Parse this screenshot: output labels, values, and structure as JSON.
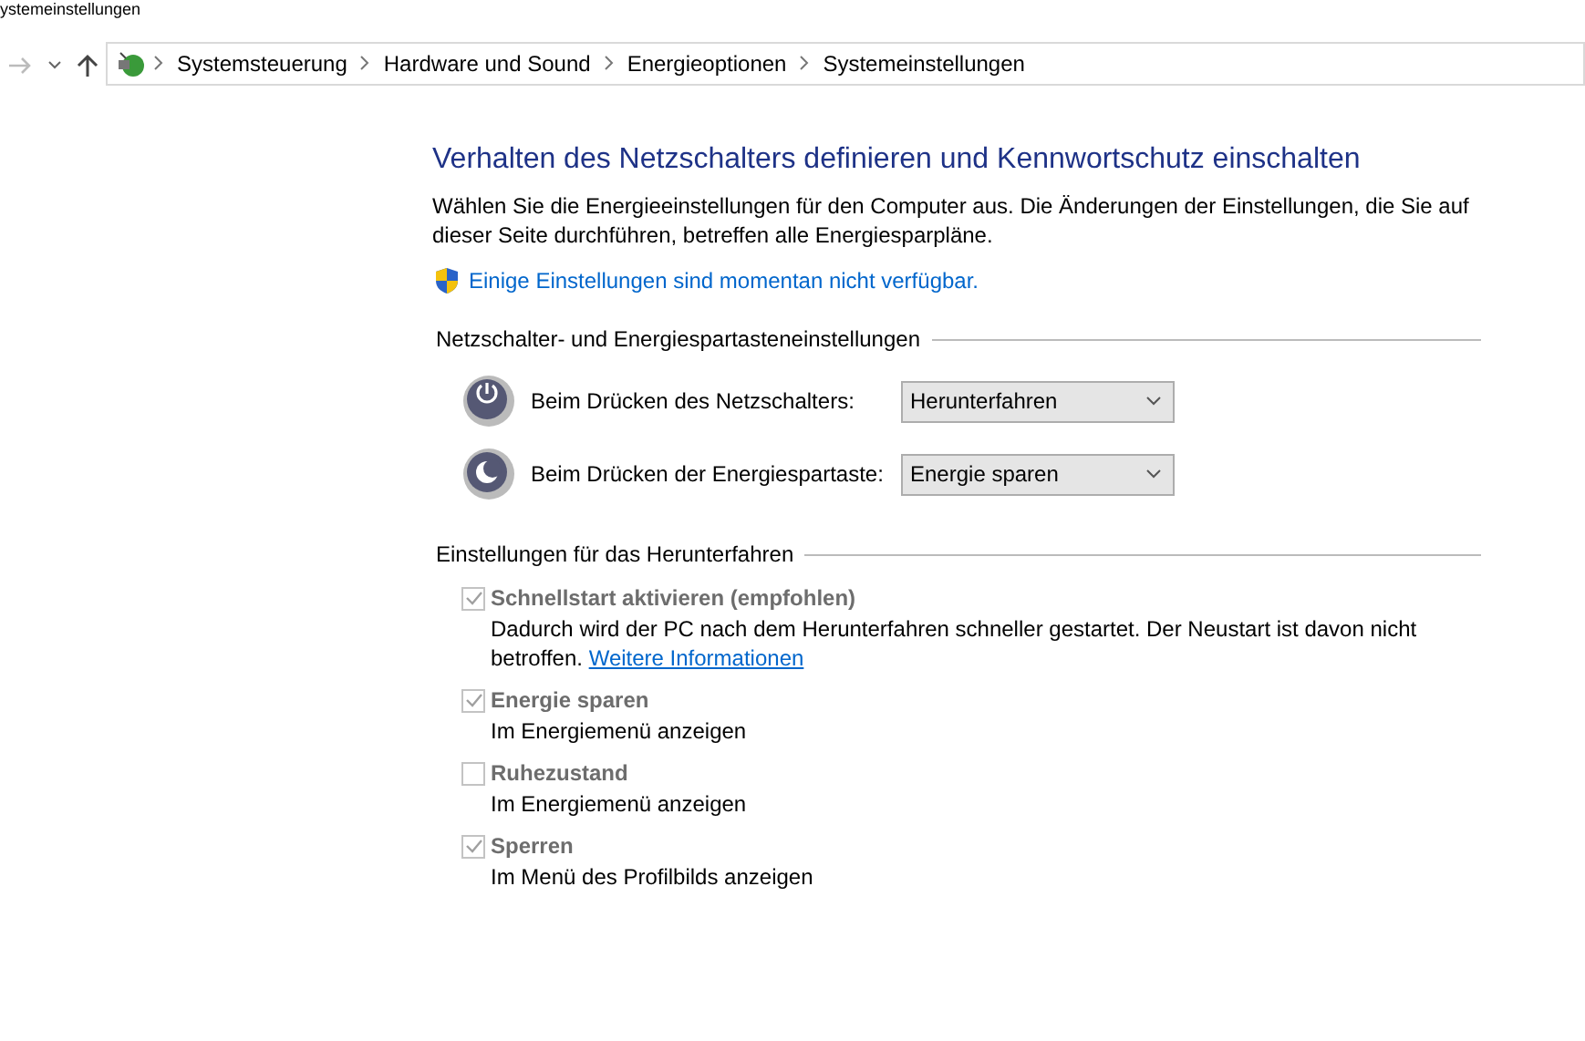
{
  "window": {
    "title": "ystemeinstellungen"
  },
  "address_bar": {
    "crumbs": [
      "Systemsteuerung",
      "Hardware und Sound",
      "Energieoptionen",
      "Systemeinstellungen"
    ]
  },
  "heading": "Verhalten des Netzschalters definieren und Kennwortschutz einschalten",
  "intro": "Wählen Sie die Energieeinstellungen für den Computer aus. Die Änderungen der Einstellungen, die Sie auf dieser Seite durchführen, betreffen alle Energiesparpläne.",
  "admin_link": "Einige Einstellungen sind momentan nicht verfügbar.",
  "button_section": {
    "title": "Netzschalter- und Energiespartasteneinstellungen",
    "rows": [
      {
        "kind": "power",
        "label": "Beim Drücken des Netzschalters:",
        "value": "Herunterfahren"
      },
      {
        "kind": "sleep",
        "label": "Beim Drücken der Energiespartaste:",
        "value": "Energie sparen"
      }
    ]
  },
  "shutdown_section": {
    "title": "Einstellungen für das Herunterfahren",
    "options": [
      {
        "label": "Schnellstart aktivieren (empfohlen)",
        "checked": true,
        "disabled": true,
        "description": "Dadurch wird der PC nach dem Herunterfahren schneller gestartet. Der Neustart ist davon nicht betroffen.",
        "link": "Weitere Informationen"
      },
      {
        "label": "Energie sparen",
        "checked": true,
        "disabled": true,
        "description": "Im Energiemenü anzeigen"
      },
      {
        "label": "Ruhezustand",
        "checked": false,
        "disabled": true,
        "description": "Im Energiemenü anzeigen"
      },
      {
        "label": "Sperren",
        "checked": true,
        "disabled": true,
        "description": "Im Menü des Profilbilds anzeigen"
      }
    ]
  }
}
